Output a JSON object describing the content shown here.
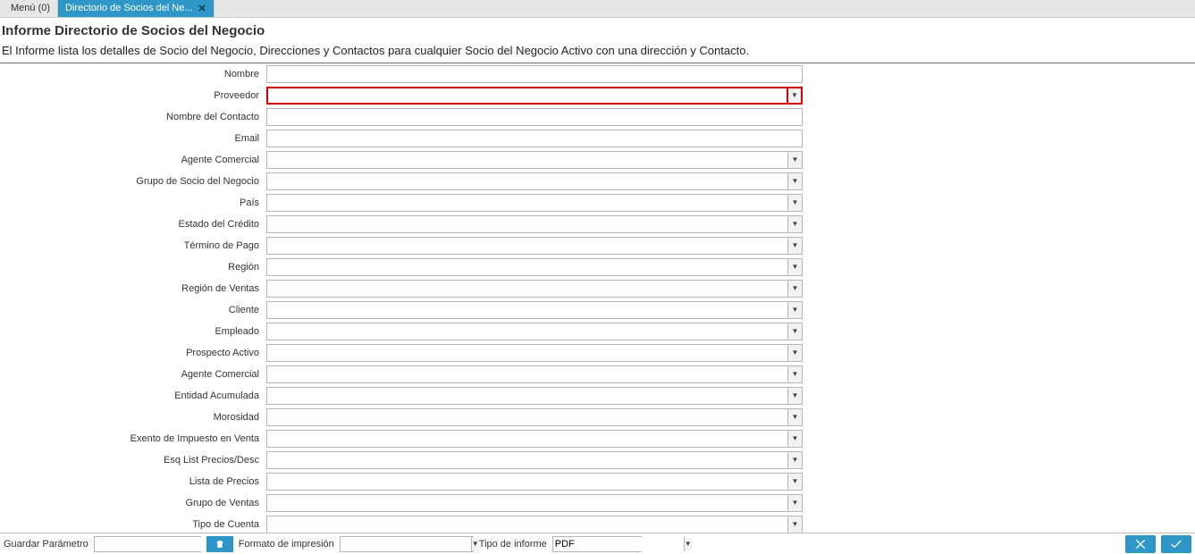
{
  "tabs": {
    "menu": "Menú (0)",
    "active": "Directorio de Socios del Ne..."
  },
  "header": {
    "title": "Informe Directorio de Socios del Negocio",
    "description": "El Informe lista los detalles de Socio del Negocio, Direcciones y Contactos para cualquier Socio del Negocio Activo con una dirección y Contacto."
  },
  "fields": [
    {
      "label": "Nombre",
      "type": "text",
      "highlight": false
    },
    {
      "label": "Proveedor",
      "type": "combo",
      "highlight": true
    },
    {
      "label": "Nombre del Contacto",
      "type": "text",
      "highlight": false
    },
    {
      "label": "Email",
      "type": "text",
      "highlight": false
    },
    {
      "label": "Agente Comercial",
      "type": "combo",
      "highlight": false
    },
    {
      "label": "Grupo de Socio del Negocio",
      "type": "combo",
      "highlight": false
    },
    {
      "label": "País",
      "type": "combo",
      "highlight": false
    },
    {
      "label": "Estado del Crédito",
      "type": "combo",
      "highlight": false
    },
    {
      "label": "Término de Pago",
      "type": "combo",
      "highlight": false
    },
    {
      "label": "Región",
      "type": "combo",
      "highlight": false
    },
    {
      "label": "Región de Ventas",
      "type": "combo",
      "highlight": false
    },
    {
      "label": "Cliente",
      "type": "combo",
      "highlight": false
    },
    {
      "label": "Empleado",
      "type": "combo",
      "highlight": false
    },
    {
      "label": "Prospecto Activo",
      "type": "combo",
      "highlight": false
    },
    {
      "label": "Agente Comercial",
      "type": "combo",
      "highlight": false
    },
    {
      "label": "Entidad Acumulada",
      "type": "combo",
      "highlight": false
    },
    {
      "label": "Morosidad",
      "type": "combo",
      "highlight": false
    },
    {
      "label": "Exento de Impuesto en Venta",
      "type": "combo",
      "highlight": false
    },
    {
      "label": "Esq List Precios/Desc",
      "type": "combo",
      "highlight": false
    },
    {
      "label": "Lista de Precios",
      "type": "combo",
      "highlight": false
    },
    {
      "label": "Grupo de Ventas",
      "type": "combo",
      "highlight": false
    },
    {
      "label": "Tipo de Cuenta",
      "type": "combo",
      "highlight": false
    }
  ],
  "footer": {
    "save_param_label": "Guardar Parámetro",
    "save_param_value": "",
    "print_format_label": "Formato de impresión",
    "print_format_value": "",
    "report_type_label": "Tipo de informe",
    "report_type_value": "PDF"
  }
}
